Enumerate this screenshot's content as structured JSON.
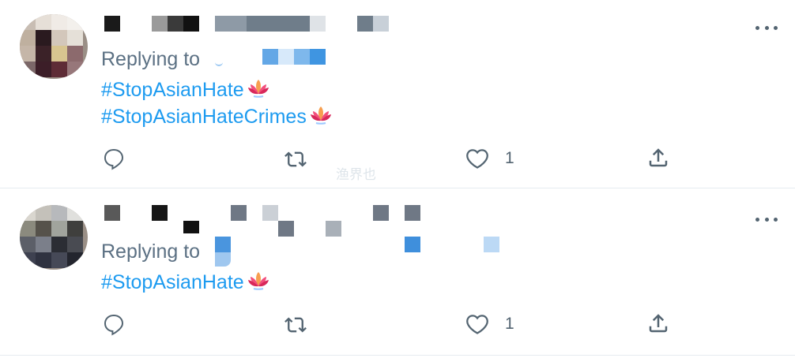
{
  "tweets": [
    {
      "replying_label": "Replying to",
      "hashtags": [
        "#StopAsianHate",
        "#StopAsianHateCrimes"
      ],
      "like_count": "1",
      "hashtag_emoji": "lotus-icon"
    },
    {
      "replying_label": "Replying to",
      "hashtags": [
        "#StopAsianHate"
      ],
      "like_count": "1",
      "hashtag_emoji": "lotus-icon"
    }
  ],
  "icons": {
    "reply": "reply-icon",
    "retweet": "retweet-icon",
    "like": "heart-icon",
    "share": "share-icon",
    "more": "more-icon"
  },
  "watermark": "渔界也",
  "colors": {
    "link": "#1d9bf0",
    "muted": "#5b7083",
    "divider": "#e6ecf0",
    "lotus_pink": "#e0245e",
    "lotus_orange": "#f6a04d"
  }
}
